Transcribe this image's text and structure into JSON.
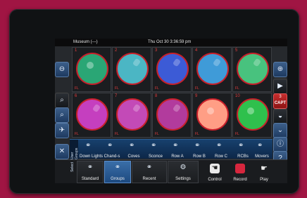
{
  "header": {
    "location": "Museum (---)",
    "datetime": "Thu Oct 30 3:36:59 pm"
  },
  "tiles": [
    {
      "num": "1",
      "label": "",
      "fl": "FL",
      "color": "#2aa675"
    },
    {
      "num": "2",
      "label": "",
      "fl": "FL",
      "color": "#4bb6c4"
    },
    {
      "num": "3",
      "label": "",
      "fl": "FL",
      "color": "#3c5bd6"
    },
    {
      "num": "4",
      "label": "",
      "fl": "FL",
      "color": "#3f9bd8"
    },
    {
      "num": "5",
      "label": "",
      "fl": "FL",
      "color": "#48c27e"
    },
    {
      "num": "6",
      "label": "",
      "fl": "FL",
      "color": "#c53fbf"
    },
    {
      "num": "7",
      "label": "",
      "fl": "FL",
      "color": "#c34ab7"
    },
    {
      "num": "8",
      "label": "",
      "fl": "FL",
      "color": "#b23b9d"
    },
    {
      "num": "9",
      "label": "",
      "fl": "FL",
      "color": "#ff9e85"
    },
    {
      "num": "10",
      "label": "",
      "fl": "FL",
      "color": "#2fc04d"
    }
  ],
  "capture": {
    "count": "3",
    "label": "CAPT"
  },
  "groups": {
    "heading": "User Groups",
    "items": [
      {
        "label": "Down Lights"
      },
      {
        "label": "Chand-s"
      },
      {
        "label": "Coves"
      },
      {
        "label": "Sconce"
      },
      {
        "label": "Row A"
      },
      {
        "label": "Row B"
      },
      {
        "label": "Row C"
      },
      {
        "label": "RCBs"
      },
      {
        "label": "Movers"
      }
    ]
  },
  "bottom": {
    "heading": "Select",
    "tabs": [
      {
        "label": "Standard"
      },
      {
        "label": "Groups"
      },
      {
        "label": "Recent"
      },
      {
        "label": "Settings"
      }
    ],
    "modes": [
      {
        "label": "Control"
      },
      {
        "label": "Record"
      },
      {
        "label": "Play"
      }
    ]
  }
}
